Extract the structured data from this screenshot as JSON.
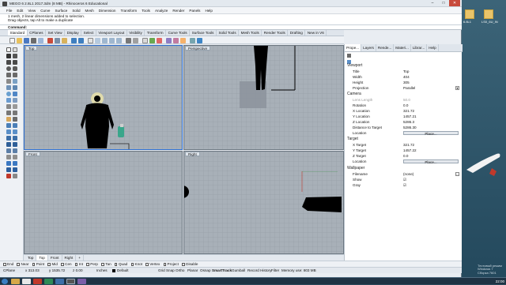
{
  "window": {
    "title": "MEGO 6 2.8L1 2017.3dm (8 MB) - Rhinoceros 6 Educational",
    "min": "–",
    "max": "□",
    "close": "✕"
  },
  "menu": [
    "File",
    "Edit",
    "View",
    "Curve",
    "Surface",
    "Solid",
    "Mesh",
    "Dimension",
    "Transform",
    "Tools",
    "Analyze",
    "Render",
    "Panels",
    "Help"
  ],
  "command_history": [
    "1 mesh, 2 linear dimensions added to selection.",
    "Drag objects, tap Alt to make a duplicate"
  ],
  "command_prompt": "Command:",
  "toolbar_tabs": [
    "Standard",
    "CPlanes",
    "Set View",
    "Display",
    "Select",
    "Viewport Layout",
    "Visibility",
    "Transform",
    "Curve Tools",
    "Surface Tools",
    "Solid Tools",
    "Mesh Tools",
    "Render Tools",
    "Drafting",
    "New in V6"
  ],
  "viewports": {
    "top": "Top",
    "perspective": "Perspective",
    "front": "Front",
    "right": "Right"
  },
  "viewport_tabs": [
    "Top",
    "Top",
    "Front",
    "Right",
    "+"
  ],
  "panel": {
    "tabs": [
      "Prope...",
      "Layers",
      "Rende...",
      "Materi...",
      "Librar...",
      "Help"
    ],
    "viewport_header": "Viewport",
    "viewport_rows": [
      {
        "k": "Title",
        "v": "Top"
      },
      {
        "k": "Width",
        "v": "404"
      },
      {
        "k": "Height",
        "v": "305"
      },
      {
        "k": "Projection",
        "v": "Parallel"
      }
    ],
    "camera_header": "Camera",
    "camera_rows": [
      {
        "k": "Lens Length",
        "v": "50.0"
      },
      {
        "k": "Rotation",
        "v": "0.0"
      },
      {
        "k": "X Location",
        "v": "321.72"
      },
      {
        "k": "Y Location",
        "v": "1457.21"
      },
      {
        "k": "Z Location",
        "v": "5286.3"
      },
      {
        "k": "Distance to Target",
        "v": "5286.30"
      }
    ],
    "location_label": "Location",
    "place_label": "Place...",
    "target_header": "Target",
    "target_rows": [
      {
        "k": "X Target",
        "v": "321.72"
      },
      {
        "k": "Y Target",
        "v": "1457.22"
      },
      {
        "k": "Z Target",
        "v": "0.0"
      }
    ],
    "wallpaper_header": "Wallpaper",
    "wallpaper_rows": [
      {
        "k": "Filename",
        "v": "(none)"
      },
      {
        "k": "Show",
        "v": "☑"
      },
      {
        "k": "Gray",
        "v": "☑"
      }
    ]
  },
  "osnap": [
    "End",
    "Near",
    "Point",
    "Mid",
    "Cen",
    "Int",
    "Perp",
    "Tan",
    "Quad",
    "Knot",
    "Vertex",
    "Project",
    "Disable"
  ],
  "status": {
    "cplane": "CPlane",
    "x": "x 313.03",
    "y": "y 1535.72",
    "z": "z 0.00",
    "units": "Inches",
    "layer": "Default",
    "grid_snap": "Grid Snap",
    "ortho": "Ortho",
    "planar": "Planar",
    "osnap": "Osnap",
    "smarttrack": "SmartTrack",
    "gumball": "Gumball",
    "record_history": "Record History",
    "filter": "Filter",
    "memory": "Memory use: 803 MB"
  },
  "desktop": {
    "icons": [
      "6.8L1",
      "LS0_6U_IN"
    ],
    "watermark": [
      "Тестовый режим",
      "Windows 7",
      "Сборка 7601"
    ],
    "clock": "22:00"
  },
  "colors": {
    "accent": "#2e6fd1",
    "viewport_bg": "#a8b0b8",
    "taskbar": "#1f3344"
  }
}
